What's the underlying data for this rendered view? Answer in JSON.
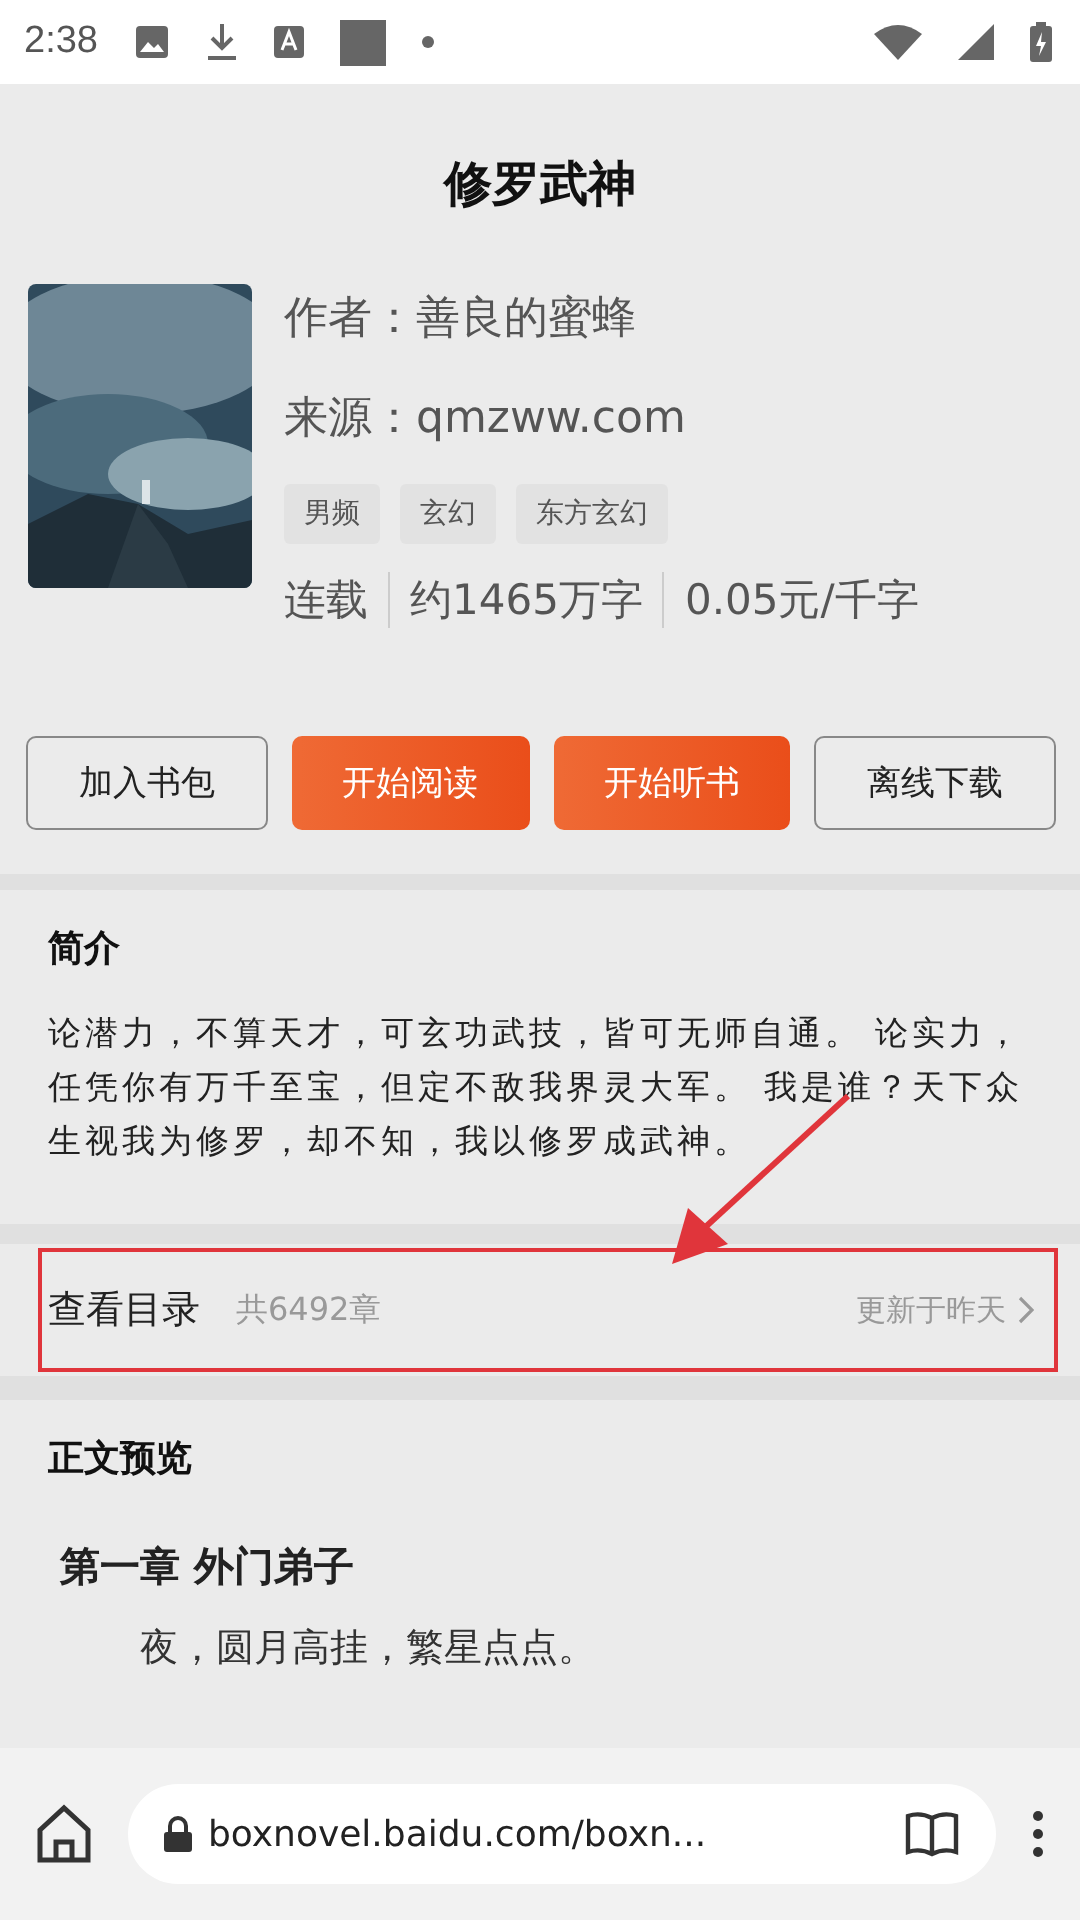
{
  "status_bar": {
    "time": "2:38"
  },
  "book": {
    "title": "修罗武神",
    "author": "作者：善良的蜜蜂",
    "source": "来源：qmzww.com",
    "tags": [
      "男频",
      "玄幻",
      "东方玄幻"
    ],
    "stats": [
      "连载",
      "约1465万字",
      "0.05元/千字"
    ]
  },
  "actions": [
    {
      "label": "加入书包",
      "kind": "outline"
    },
    {
      "label": "开始阅读",
      "kind": "primary"
    },
    {
      "label": "开始听书",
      "kind": "primary"
    },
    {
      "label": "离线下载",
      "kind": "outline"
    }
  ],
  "intro": {
    "heading": "简介",
    "text": "论潜力，不算天才，可玄功武技，皆可无师自通。 论实力，任凭你有万千至宝，但定不敌我界灵大军。 我是谁？天下众生视我为修罗，却不知，我以修罗成武神。"
  },
  "catalogue": {
    "label": "查看目录",
    "count": "共6492章",
    "updated": "更新于昨天",
    "highlighted": true
  },
  "preview": {
    "heading": "正文预览",
    "chapter": "第一章 外门弟子",
    "paragraphs": [
      "夜，圆月高挂，繁星点点。"
    ]
  },
  "browser": {
    "url": "boxnovel.baidu.com/boxn..."
  }
}
